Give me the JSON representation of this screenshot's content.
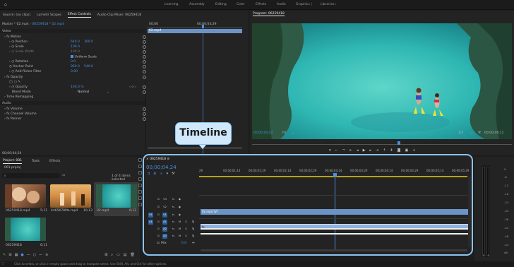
{
  "workspaces": {
    "home": "⌂",
    "items": [
      "Learning",
      "Assembly",
      "Editing",
      "Color",
      "Effects",
      "Audio",
      "Graphics",
      "Libraries"
    ],
    "active": "Graphics"
  },
  "source_panel": {
    "tabs": [
      "Source: (no clips)",
      "Lumetri Scopes",
      "Effect Controls",
      "Audio Clip Mixer: 06259418"
    ],
    "active_tab": "Effect Controls",
    "breadcrumb_master": "Master * 02.mp4",
    "breadcrumb_clip": "06259418 * 02.mp4",
    "timecode_left": "00;00",
    "timecode_right": "00;00;04;29",
    "clip_bar_label": "02.mp4",
    "section_video": "Video",
    "motion": "Motion",
    "position": {
      "label": "Position",
      "x": "640.0",
      "y": "360.0"
    },
    "scale": {
      "label": "Scale",
      "value": "100.0"
    },
    "scale_width": {
      "label": "Scale Width",
      "value": "100.0"
    },
    "uniform_scale": "Uniform Scale",
    "rotation": {
      "label": "Rotation",
      "value": "0.0"
    },
    "anchor_point": {
      "label": "Anchor Point",
      "x": "960.0",
      "y": "540.0"
    },
    "anti_flicker": {
      "label": "Anti-flicker Filter",
      "value": "0.00"
    },
    "opacity": "Opacity",
    "opacity_value": {
      "label": "Opacity",
      "value": "100.0 %"
    },
    "blend_mode": {
      "label": "Blend Mode",
      "value": "Normal"
    },
    "time_remapping": "Time Remapping",
    "section_audio": "Audio",
    "volume": "Volume",
    "channel_volume": "Channel Volume",
    "panner": "Panner",
    "bottom_timecode": "00;00;04;24"
  },
  "program": {
    "title": "Program: 06259418",
    "timecode": "00;00;04;24",
    "fit": "Fit",
    "fraction": "1/2",
    "duration": "00;00;06;11"
  },
  "project": {
    "tabs": [
      "Project: 001",
      "Tools",
      "Effects"
    ],
    "active_tab": "Project: 001",
    "file_name": "001.prproj",
    "items_selected": "1 of 4 items selected",
    "items": [
      {
        "name": "06259418.mp4",
        "duration": "5;11"
      },
      {
        "name": "4465678Ma.mp4",
        "duration": "10;13"
      },
      {
        "name": "02.mp4",
        "duration": "6;12"
      },
      {
        "name": "06259418",
        "duration": "6;11"
      }
    ]
  },
  "timeline": {
    "sequence": "06259418",
    "timecode": "00;00;04;24",
    "ticks": [
      "29",
      "00;00;01;14",
      "00;00;01;29",
      "00;00;02;14",
      "00;00;02;29",
      "00;00;03;14",
      "00;00;03;29",
      "00;00;04;14",
      "00;00;04;29",
      "00;00;05;14",
      "00;00;05;29",
      "00;00;06;14"
    ],
    "video_tracks": [
      "V3",
      "V2",
      "V1"
    ],
    "audio_tracks": [
      "A1",
      "A2",
      "A3"
    ],
    "clip_v1": "02.mp4 [V]",
    "clip_a1": "fx",
    "mix_label": "Mix",
    "mix_value": "0.0"
  },
  "annotation": {
    "label": "Timeline"
  },
  "meter": {
    "labels": [
      "0",
      "-6",
      "-12",
      "-18",
      "-24",
      "-30",
      "-36",
      "-42",
      "-48",
      "-54",
      "dB"
    ],
    "solo": [
      "S",
      "S"
    ]
  },
  "status_bar": "Click to select, or click in empty space and drag to marquee select. Use Shift, Alt, and Ctrl for other options."
}
